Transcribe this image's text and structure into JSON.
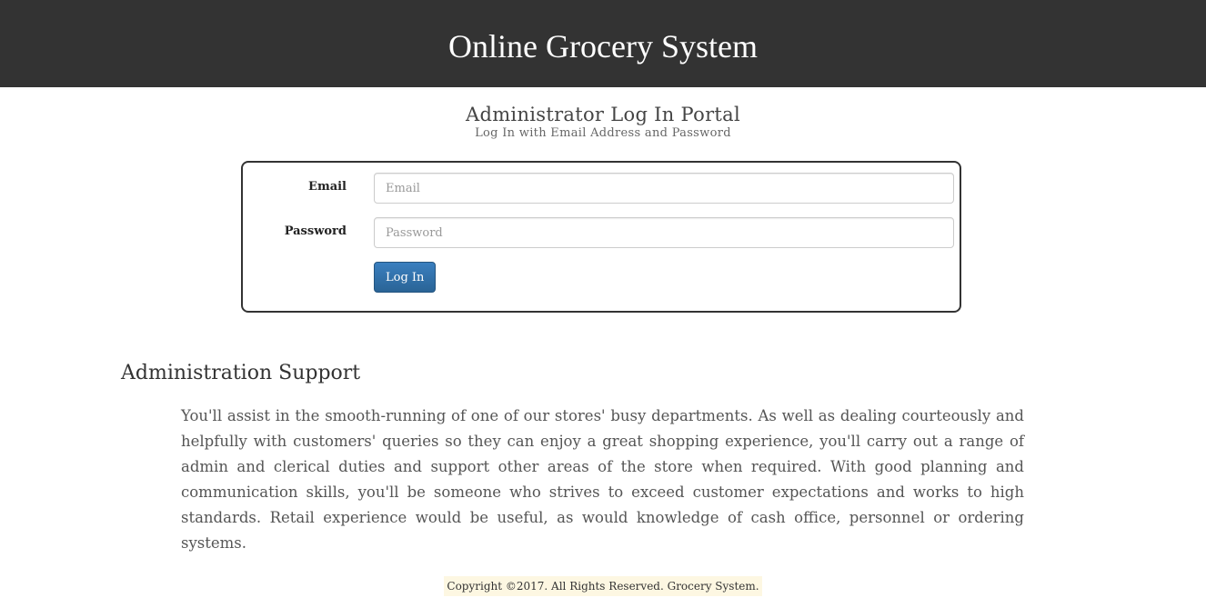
{
  "header": {
    "site_title": "Online Grocery System"
  },
  "portal": {
    "title": "Administrator Log In Portal",
    "subtitle": "Log In with Email Address and Password"
  },
  "form": {
    "email_label": "Email",
    "email_placeholder": "Email",
    "email_value": "",
    "password_label": "Password",
    "password_placeholder": "Password",
    "password_value": "",
    "submit_label": "Log In"
  },
  "support": {
    "title": "Administration Support",
    "body": "You'll assist in the smooth-running of one of our stores' busy departments. As well as dealing courteously and helpfully with customers' queries so they can enjoy a great shopping experience, you'll carry out a range of admin and clerical duties and support other areas of the store when required. With good planning and communication skills, you'll be someone who strives to exceed customer expectations and works to high standards. Retail experience would be useful, as would knowledge of cash office, personnel or ordering systems."
  },
  "footer": {
    "copyright": "Copyright ©2017. All Rights Reserved. Grocery System."
  },
  "colors": {
    "header_bg": "#333333",
    "button_bg": "#337ab7",
    "footer_highlight": "#fdf7e2"
  }
}
